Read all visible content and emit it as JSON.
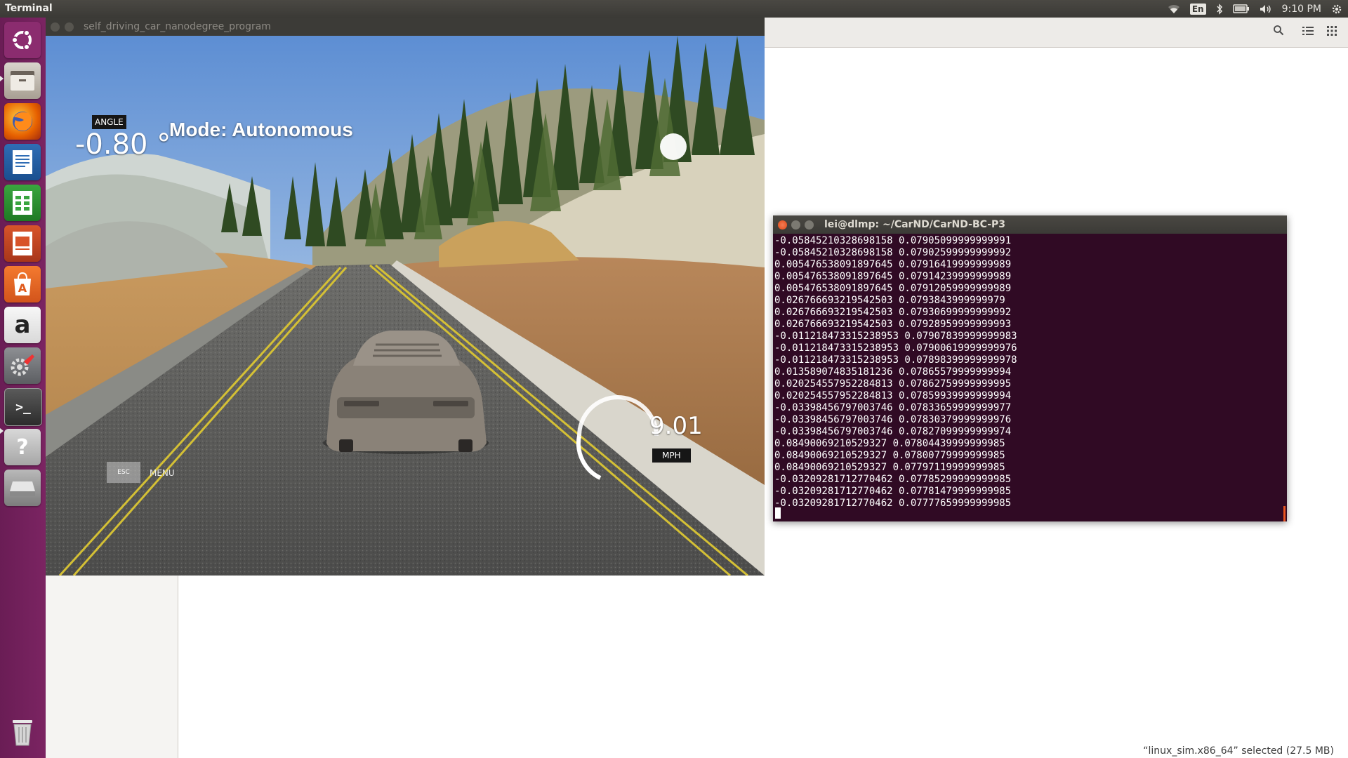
{
  "top_panel": {
    "title": "Terminal",
    "keyboard_layout": "En",
    "clock": "9:10 PM"
  },
  "launcher": {
    "items": [
      {
        "name": "Dash",
        "icon": "ubuntu-logo-icon"
      },
      {
        "name": "Files",
        "icon": "files-icon"
      },
      {
        "name": "Firefox",
        "icon": "firefox-icon"
      },
      {
        "name": "LibreOffice Writer",
        "icon": "writer-icon"
      },
      {
        "name": "LibreOffice Calc",
        "icon": "calc-icon"
      },
      {
        "name": "LibreOffice Impress",
        "icon": "impress-icon"
      },
      {
        "name": "Ubuntu Software",
        "icon": "software-center-icon"
      },
      {
        "name": "Amazon",
        "icon": "amazon-icon",
        "glyph": "a"
      },
      {
        "name": "System Settings",
        "icon": "settings-icon"
      },
      {
        "name": "Terminal",
        "icon": "terminal-icon",
        "glyph": ">_"
      },
      {
        "name": "Help",
        "icon": "help-icon",
        "glyph": "?"
      },
      {
        "name": "Drive",
        "icon": "drive-icon"
      }
    ],
    "trash": "Trash"
  },
  "simulator": {
    "window_title": "self_driving_car_nanodegree_program",
    "angle_tag": "ANGLE",
    "angle_value": "-0.80 °",
    "mode": "Mode: Autonomous",
    "speed_value": "9.01",
    "speed_unit": "MPH",
    "esc_key": "ESC",
    "menu_label": "MENU"
  },
  "terminal": {
    "title": "lei@dlmp: ~/CarND/CarND-BC-P3",
    "lines": [
      "-0.05845210328698158 0.07905099999999991",
      "-0.05845210328698158 0.07902599999999992",
      "0.005476538091897645 0.07916419999999989",
      "0.005476538091897645 0.07914239999999989",
      "0.005476538091897645 0.07912059999999989",
      "0.026766693219542503 0.0793843999999979",
      "0.026766693219542503 0.07930699999999992",
      "0.026766693219542503 0.07928959999999993",
      "-0.011218473315238953 0.07907839999999983",
      "-0.011218473315238953 0.07900619999999976",
      "-0.011218473315238953 0.07898399999999978",
      "0.013589074835181236 0.07865579999999994",
      "0.020254557952284813 0.07862759999999995",
      "0.020254557952284813 0.07859939999999994",
      "-0.03398456797003746 0.07833659999999977",
      "-0.03398456797003746 0.07830379999999976",
      "-0.03398456797003746 0.07827099999999974",
      "0.08490069210529327 0.07804439999999985",
      "0.08490069210529327 0.07800779999999985",
      "0.08490069210529327 0.07797119999999985",
      "-0.03209281712770462 0.07785299999999985",
      "-0.03209281712770462 0.07781479999999985",
      "-0.03209281712770462 0.07777659999999985"
    ]
  },
  "file_manager": {
    "status": "“linux_sim.x86_64” selected  (27.5 MB)"
  },
  "colors": {
    "launcher": "#7b2462",
    "terminal_bg": "#300a24",
    "panel": "#3c3b37",
    "accent": "#e95420"
  }
}
